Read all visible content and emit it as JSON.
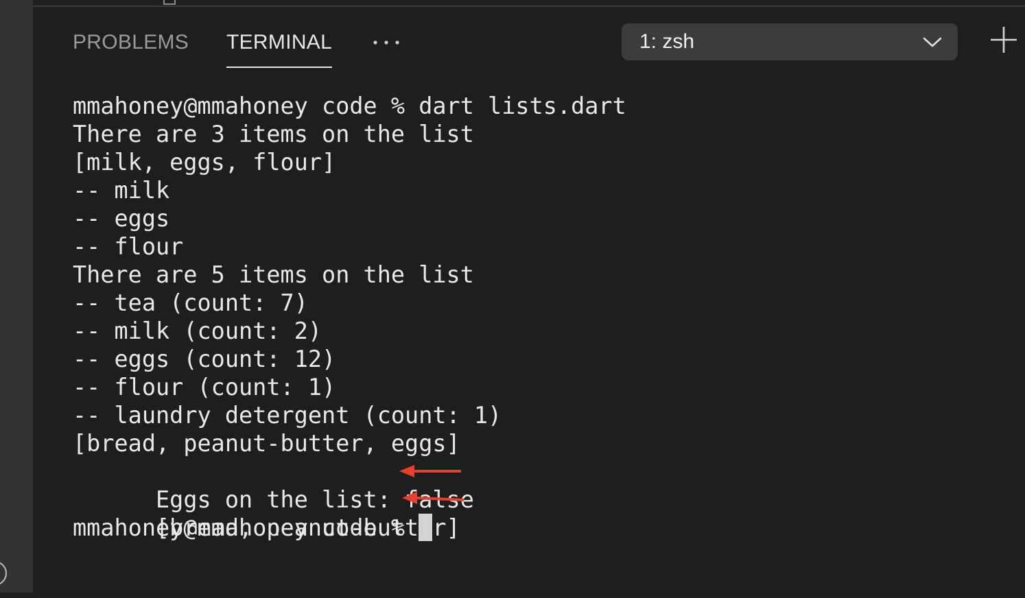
{
  "panel": {
    "tabs": [
      {
        "label": "PROBLEMS",
        "active": false
      },
      {
        "label": "TERMINAL",
        "active": true
      }
    ],
    "more_icon": "ellipsis-icon",
    "shell_select": {
      "value": "1: zsh",
      "icon": "chevron-down-icon"
    },
    "new_terminal_icon": "plus-icon"
  },
  "terminal": {
    "lines": [
      "mmahoney@mmahoney code % dart lists.dart",
      "There are 3 items on the list",
      "[milk, eggs, flour]",
      "-- milk",
      "-- eggs",
      "-- flour",
      "There are 5 items on the list",
      "-- tea (count: 7)",
      "-- milk (count: 2)",
      "-- eggs (count: 12)",
      "-- flour (count: 1)",
      "-- laundry detergent (count: 1)",
      "[bread, peanut-butter, eggs]",
      "Eggs on the list: false",
      "[bread, peanut-butter]",
      "mmahoney@mmahoney code % "
    ]
  },
  "colors": {
    "background": "#1e1e1e",
    "text": "#e8e8e8",
    "annotation_arrow": "#e8402f"
  }
}
